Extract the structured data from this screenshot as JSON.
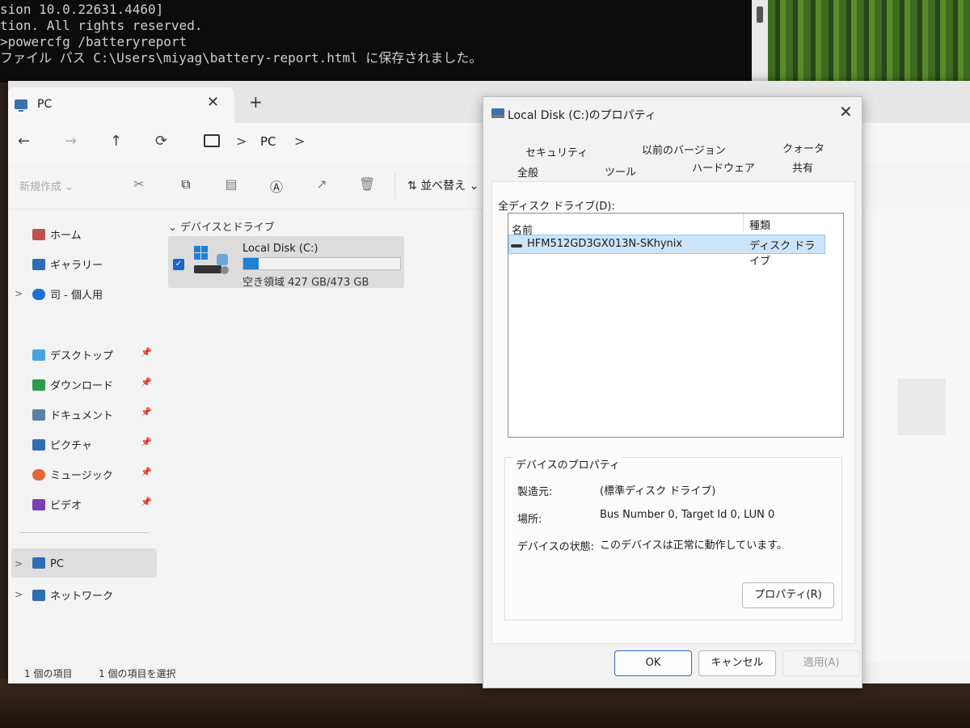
{
  "terminal": {
    "lines": [
      "sion 10.0.22631.4460]",
      "tion. All rights reserved.",
      "",
      ">powercfg /batteryreport",
      "ファイル パス C:\\Users\\miyag\\battery-report.html に保存されました。"
    ]
  },
  "explorer": {
    "tab_title": "PC",
    "tab_close": "✕",
    "tab_new": "+",
    "nav": {
      "back": "←",
      "forward": "→",
      "up": "↑",
      "refresh": "⟳"
    },
    "breadcrumb": {
      "item": "PC",
      "sep": ">"
    },
    "toolbar": {
      "new_label": "新規作成 ⌄",
      "sort_label": "並べ替え ⌄",
      "icons": [
        "cut-icon",
        "copy-icon",
        "paste-icon",
        "rename-icon",
        "share-icon",
        "delete-icon"
      ]
    },
    "sidebar": {
      "items": [
        {
          "label": "ホーム",
          "icon": "home-icon",
          "color": "#c0504d"
        },
        {
          "label": "ギャラリー",
          "icon": "gallery-icon",
          "color": "#2f6db5"
        },
        {
          "label": "司 - 個人用",
          "icon": "onedrive-icon",
          "color": "#1f6fd0"
        },
        {
          "label": "デスクトップ",
          "icon": "desktop-icon",
          "color": "#4aa3df",
          "pin": "📌"
        },
        {
          "label": "ダウンロード",
          "icon": "download-icon",
          "color": "#2b9a4c",
          "pin": "📌"
        },
        {
          "label": "ドキュメント",
          "icon": "documents-icon",
          "color": "#5b7fa8",
          "pin": "📌"
        },
        {
          "label": "ピクチャ",
          "icon": "pictures-icon",
          "color": "#2f6db5",
          "pin": "📌"
        },
        {
          "label": "ミュージック",
          "icon": "music-icon",
          "color": "#e0683b",
          "pin": "📌"
        },
        {
          "label": "ビデオ",
          "icon": "videos-icon",
          "color": "#7a3fb0",
          "pin": "📌"
        },
        {
          "label": "PC",
          "icon": "pc-icon",
          "color": "#2f6db5"
        },
        {
          "label": "ネットワーク",
          "icon": "network-icon",
          "color": "#2f6db5"
        }
      ]
    },
    "content": {
      "section_title": "⌄ デバイスとドライブ",
      "drive": {
        "name": "Local Disk (C:)",
        "free_text": "空き領域 427 GB/473 GB",
        "used_fraction": 0.1
      }
    },
    "status": {
      "count": "1 個の項目",
      "selected": "1 個の項目を選択"
    }
  },
  "dialog": {
    "title": "Local Disk (C:)のプロパティ",
    "close": "✕",
    "tabs_row1": [
      "セキュリティ",
      "以前のバージョン",
      "クォータ"
    ],
    "tabs_row2": [
      "全般",
      "ツール",
      "ハードウェア",
      "共有"
    ],
    "list_caption": "全ディスク ドライブ(D):",
    "columns": {
      "name": "名前",
      "type": "種類"
    },
    "disk": {
      "name": "HFM512GD3GX013N-SKhynix",
      "type": "ディスク ドライブ"
    },
    "device_props": {
      "caption": "デバイスのプロパティ",
      "manufacturer_label": "製造元:",
      "manufacturer_value": "(標準ディスク ドライブ)",
      "location_label": "場所:",
      "location_value": "Bus Number 0, Target Id 0, LUN 0",
      "status_label": "デバイスの状態:",
      "status_value": "このデバイスは正常に動作しています。"
    },
    "buttons": {
      "properties": "プロパティ(R)",
      "ok": "OK",
      "cancel": "キャンセル",
      "apply": "適用(A)"
    }
  },
  "colors": {
    "accent": "#1f63c9",
    "selection": "#cce4f7",
    "storage_bar": "#1f80d6"
  }
}
